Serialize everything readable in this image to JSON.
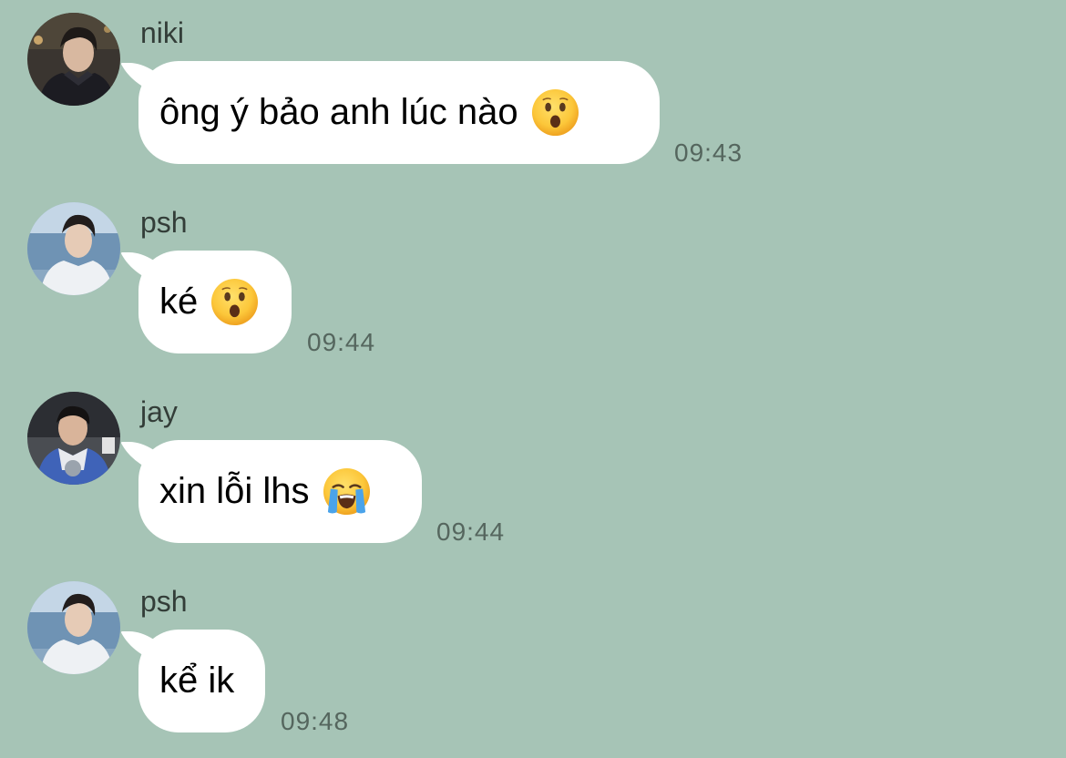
{
  "messages": [
    {
      "sender": "niki",
      "text": "ông ý bảo anh lúc nào",
      "emoji": "hushed-face",
      "time": "09:43"
    },
    {
      "sender": "psh",
      "text": "ké",
      "emoji": "hushed-face",
      "time": "09:44"
    },
    {
      "sender": "jay",
      "text": "xin lỗi lhs",
      "emoji": "loudly-crying-face",
      "time": "09:44"
    },
    {
      "sender": "psh",
      "text": "kể ik",
      "emoji": "",
      "time": "09:48"
    }
  ],
  "colors": {
    "background": "#a6c4b6",
    "bubble": "#ffffff",
    "sender_text": "#333d38",
    "time_text": "#55665e"
  }
}
